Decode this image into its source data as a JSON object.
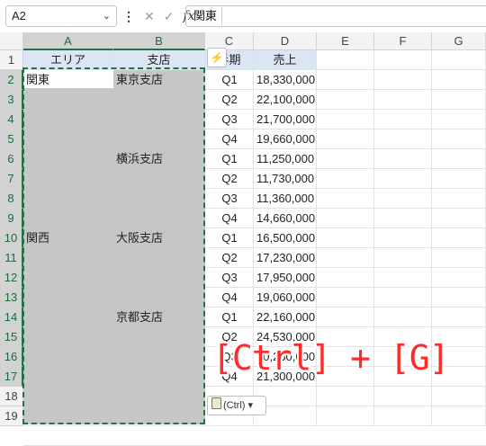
{
  "formula_bar": {
    "name_box": "A2",
    "formula": "関東",
    "fx": "fx"
  },
  "columns": [
    "A",
    "B",
    "C",
    "D",
    "E",
    "F",
    "G"
  ],
  "rows": [
    "1",
    "2",
    "3",
    "4",
    "5",
    "6",
    "7",
    "8",
    "9",
    "10",
    "11",
    "12",
    "13",
    "14",
    "15",
    "16",
    "17",
    "18",
    "19"
  ],
  "headers": {
    "area": "エリア",
    "branch": "支店",
    "half": "半期",
    "sales": "売上"
  },
  "table": {
    "area": [
      "関東",
      "",
      "",
      "",
      "",
      "",
      "",
      "",
      "関西",
      "",
      "",
      "",
      "",
      "",
      "",
      ""
    ],
    "branch": [
      "東京支店",
      "",
      "",
      "",
      "横浜支店",
      "",
      "",
      "",
      "大阪支店",
      "",
      "",
      "",
      "京都支店",
      "",
      "",
      ""
    ],
    "half": [
      "Q1",
      "Q2",
      "Q3",
      "Q4",
      "Q1",
      "Q2",
      "Q3",
      "Q4",
      "Q1",
      "Q2",
      "Q3",
      "Q4",
      "Q1",
      "Q2",
      "Q3",
      "Q4"
    ],
    "sales": [
      "18,330,000",
      "22,100,000",
      "21,700,000",
      "19,660,000",
      "11,250,000",
      "11,730,000",
      "11,360,000",
      "14,660,000",
      "16,500,000",
      "17,230,000",
      "17,950,000",
      "19,060,000",
      "22,160,000",
      "24,530,000",
      "20,260,000",
      "21,300,000"
    ]
  },
  "paste_options": "(Ctrl)",
  "overlay_text": "[Ctrl] + [G]",
  "colors": {
    "accent": "#217346",
    "overlay": "#ff2a2a",
    "header_fill": "#dbe6f4"
  }
}
